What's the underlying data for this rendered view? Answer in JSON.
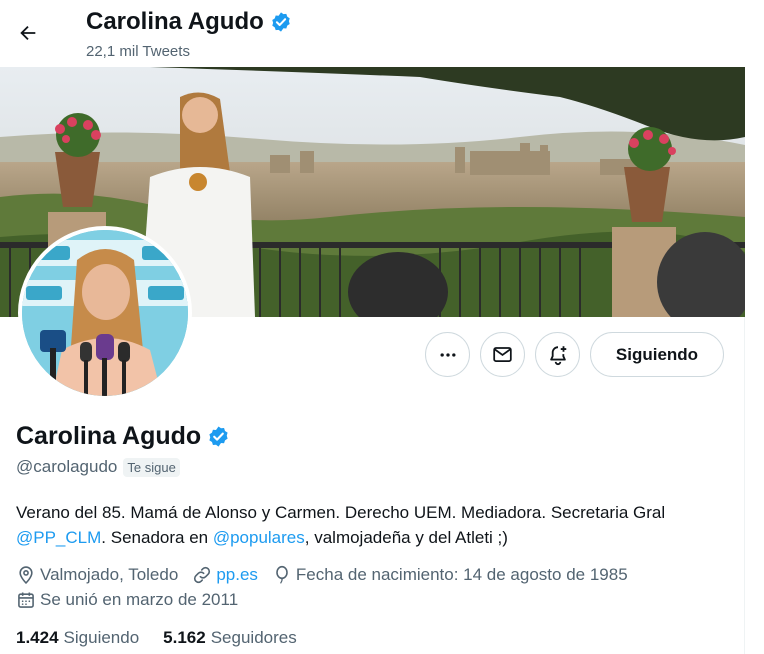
{
  "header": {
    "name": "Carolina Agudo",
    "tweet_count": "22,1 mil Tweets"
  },
  "profile": {
    "name": "Carolina Agudo",
    "handle": "@carolagudo",
    "follows_you": "Te sigue",
    "bio": {
      "text1": "Verano del 85. Mamá de Alonso y Carmen. Derecho UEM. Mediadora. Secretaria Gral ",
      "mention1": "@PP_CLM",
      "text2": ". Senadora en ",
      "mention2": "@populares",
      "text3": ", valmojadeña y del Atleti ;)"
    },
    "location": "Valmojado, Toledo",
    "website": "pp.es",
    "birthday": "Fecha de nacimiento: 14 de agosto de 1985",
    "joined": "Se unió en marzo de 2011"
  },
  "actions": {
    "follow_label": "Siguiendo"
  },
  "stats": {
    "following_count": "1.424",
    "following_label": "Siguiendo",
    "followers_count": "5.162",
    "followers_label": "Seguidores"
  },
  "colors": {
    "accent": "#1d9bf0",
    "verified": "#1d9bf0",
    "secondary_text": "#536471"
  },
  "icons": {
    "back": "arrow-left-icon",
    "verified": "verified-badge-icon",
    "more": "more-dots-icon",
    "message": "envelope-icon",
    "notify": "bell-plus-icon",
    "location": "location-pin-icon",
    "link": "link-icon",
    "birthday": "balloon-icon",
    "calendar": "calendar-icon"
  }
}
